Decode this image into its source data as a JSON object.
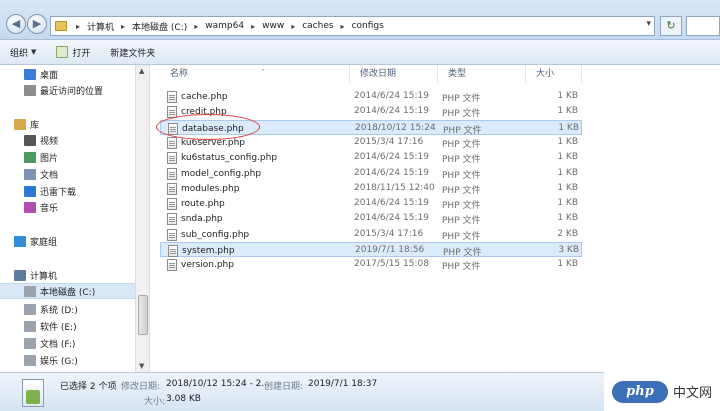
{
  "address": {
    "crumbs": [
      "计算机",
      "本地磁盘 (C:)",
      "wamp64",
      "www",
      "caches",
      "configs"
    ]
  },
  "toolbar": {
    "organize": "组织",
    "open": "打开",
    "new_folder": "新建文件夹"
  },
  "sidebar": {
    "items": [
      {
        "label": "桌面",
        "icon": "desktop-icon"
      },
      {
        "label": "最近访问的位置",
        "icon": "recent-places-icon"
      },
      {
        "label": "库",
        "icon": "library-icon"
      },
      {
        "label": "视频",
        "icon": "video-icon"
      },
      {
        "label": "图片",
        "icon": "picture-icon"
      },
      {
        "label": "文档",
        "icon": "document-icon"
      },
      {
        "label": "迅雷下载",
        "icon": "download-icon"
      },
      {
        "label": "音乐",
        "icon": "music-icon"
      },
      {
        "label": "家庭组",
        "icon": "homegroup-icon"
      },
      {
        "label": "计算机",
        "icon": "computer-icon"
      },
      {
        "label": "本地磁盘 (C:)",
        "icon": "drive-icon"
      },
      {
        "label": "系统 (D:)",
        "icon": "drive-icon"
      },
      {
        "label": "软件 (E:)",
        "icon": "drive-icon"
      },
      {
        "label": "文档 (F:)",
        "icon": "drive-icon"
      },
      {
        "label": "娱乐 (G:)",
        "icon": "drive-icon"
      }
    ]
  },
  "columns": {
    "name": "名称",
    "modified": "修改日期",
    "type": "类型",
    "size": "大小"
  },
  "files": [
    {
      "name": "cache.php",
      "modified": "2014/6/24 15:19",
      "type": "PHP 文件",
      "size": "1 KB",
      "selected": false
    },
    {
      "name": "credit.php",
      "modified": "2014/6/24 15:19",
      "type": "PHP 文件",
      "size": "1 KB",
      "selected": false
    },
    {
      "name": "database.php",
      "modified": "2018/10/12 15:24",
      "type": "PHP 文件",
      "size": "1 KB",
      "selected": true
    },
    {
      "name": "ku6server.php",
      "modified": "2015/3/4 17:16",
      "type": "PHP 文件",
      "size": "1 KB",
      "selected": false
    },
    {
      "name": "ku6status_config.php",
      "modified": "2014/6/24 15:19",
      "type": "PHP 文件",
      "size": "1 KB",
      "selected": false
    },
    {
      "name": "model_config.php",
      "modified": "2014/6/24 15:19",
      "type": "PHP 文件",
      "size": "1 KB",
      "selected": false
    },
    {
      "name": "modules.php",
      "modified": "2018/11/15 12:40",
      "type": "PHP 文件",
      "size": "1 KB",
      "selected": false
    },
    {
      "name": "route.php",
      "modified": "2014/6/24 15:19",
      "type": "PHP 文件",
      "size": "1 KB",
      "selected": false
    },
    {
      "name": "snda.php",
      "modified": "2014/6/24 15:19",
      "type": "PHP 文件",
      "size": "1 KB",
      "selected": false
    },
    {
      "name": "sub_config.php",
      "modified": "2015/3/4 17:16",
      "type": "PHP 文件",
      "size": "2 KB",
      "selected": false
    },
    {
      "name": "system.php",
      "modified": "2019/7/1 18:56",
      "type": "PHP 文件",
      "size": "3 KB",
      "selected": true
    },
    {
      "name": "version.php",
      "modified": "2017/5/15 15:08",
      "type": "PHP 文件",
      "size": "1 KB",
      "selected": false
    }
  ],
  "status": {
    "selected_count": "已选择 2 个项",
    "modified_label": "修改日期:",
    "modified_value": "2018/10/12 15:24 - 2...",
    "created_label": "创建日期:",
    "created_value": "2019/7/1 18:37",
    "size_label": "大小:",
    "size_value": "3.08 KB"
  },
  "watermark": {
    "logo": "php",
    "text": "中文网"
  }
}
